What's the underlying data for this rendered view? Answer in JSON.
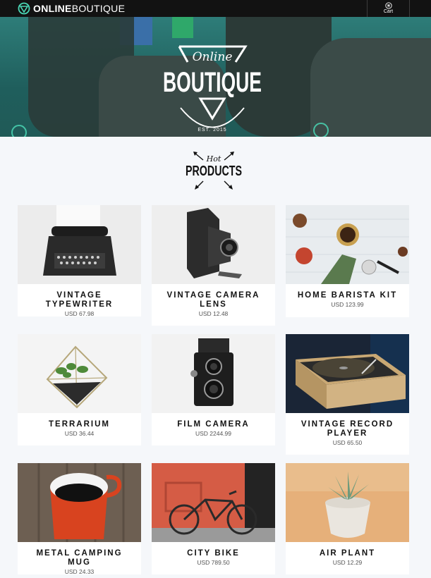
{
  "header": {
    "logo_bold": "ONLINE",
    "logo_light": "BOUTIQUE",
    "cart_label": "Cart"
  },
  "hero": {
    "script_text": "Online",
    "main_text": "BOUTIQUE",
    "est_text": "EST. 2015"
  },
  "section": {
    "hot_text": "Hot",
    "products_text": "PRODUCTS"
  },
  "products": [
    {
      "name": "VINTAGE TYPEWRITER",
      "price": "USD 67.98"
    },
    {
      "name": "VINTAGE CAMERA LENS",
      "price": "USD 12.48"
    },
    {
      "name": "HOME BARISTA KIT",
      "price": "USD 123.99"
    },
    {
      "name": "TERRARIUM",
      "price": "USD 36.44"
    },
    {
      "name": "FILM CAMERA",
      "price": "USD 2244.99"
    },
    {
      "name": "VINTAGE RECORD PLAYER",
      "price": "USD 65.50"
    },
    {
      "name": "METAL CAMPING MUG",
      "price": "USD 24.33"
    },
    {
      "name": "CITY BIKE",
      "price": "USD 789.50"
    },
    {
      "name": "AIR PLANT",
      "price": "USD 12.29"
    }
  ],
  "colors": {
    "header_bg": "#121212",
    "page_bg": "#f5f7fa",
    "accent_teal": "#4ad6b4"
  }
}
